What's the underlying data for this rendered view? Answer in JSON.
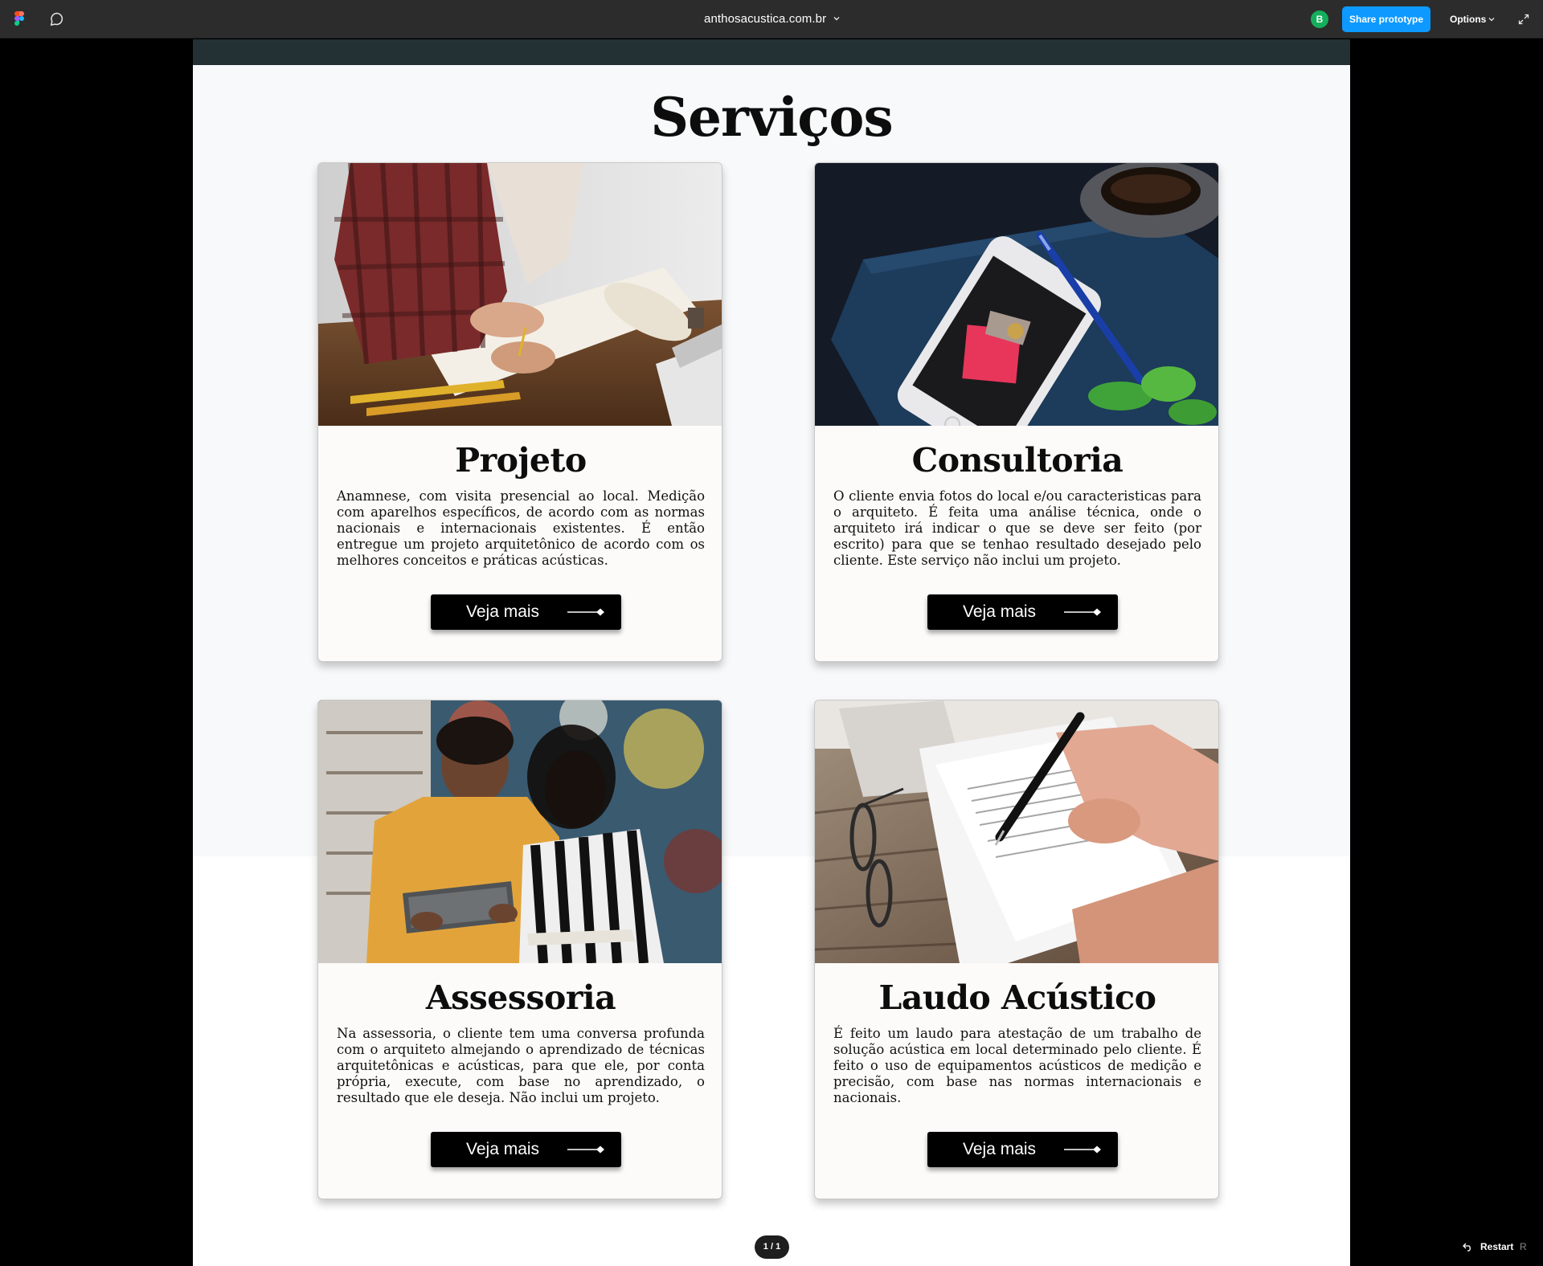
{
  "toolbar": {
    "site_title": "anthosacustica.com.br",
    "avatar_initial": "B",
    "share_label": "Share prototype",
    "options_label": "Options",
    "icons": [
      "figma-logo-icon",
      "comment-icon",
      "chevron-down-icon",
      "expand-icon"
    ]
  },
  "page": {
    "section_title": "Serviços",
    "cards": [
      {
        "title": "Projeto",
        "description": "Anamnese, com visita presencial ao local. Medição com aparelhos específicos, de acordo com as normas nacionais e internacionais existentes. É então entregue um projeto arquitetônico de acordo com os melhores conceitos e práticas acústicas.",
        "button_label": "Veja mais"
      },
      {
        "title": "Consultoria",
        "description": "O cliente envia fotos do local e/ou caracteristicas para o arquiteto. É feita uma análise técnica, onde o arquiteto irá indicar o que se deve ser feito (por escrito) para que se tenhao resultado desejado pelo cliente. Este serviço não inclui um projeto.",
        "button_label": "Veja mais"
      },
      {
        "title": "Assessoria",
        "description": "Na assessoria, o cliente tem uma conversa profunda com o arquiteto almejando o aprendizado de técnicas arquitetônicas e acústicas, para que ele, por conta própria, execute, com base no aprendizado, o resultado que ele deseja. Não inclui um projeto.",
        "button_label": "Veja mais"
      },
      {
        "title": "Laudo Acústico",
        "description": "É feito um laudo para atestação de um trabalho de solução acústica em local determinado pelo cliente. É feito o uso de equipamentos acústicos de medição e precisão, com base nas normas internacionais e nacionais.",
        "button_label": "Veja mais"
      }
    ]
  },
  "footer": {
    "pager": "1 / 1",
    "restart_label": "Restart",
    "restart_shortcut": "R"
  },
  "colors": {
    "toolbar_bg": "#2c2c2c",
    "share_button": "#0d99ff",
    "avatar": "#14ae5c",
    "frame_header": "#233135",
    "button_bg": "#000000"
  }
}
